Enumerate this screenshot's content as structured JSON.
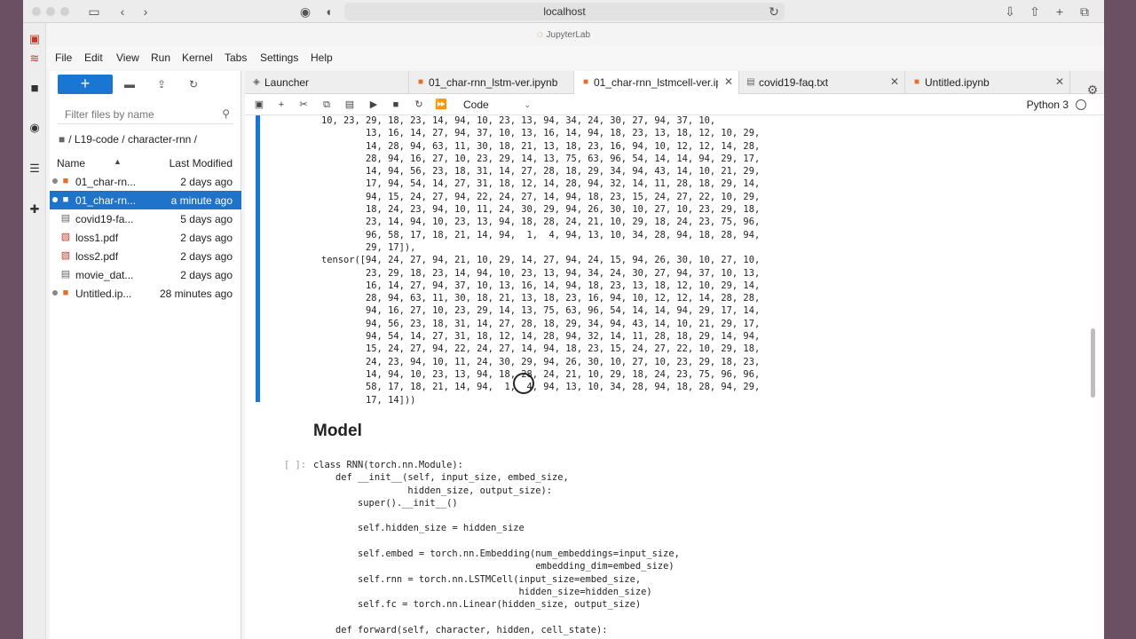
{
  "browser": {
    "url": "localhost",
    "app_name": "JupyterLab"
  },
  "menu": [
    "File",
    "Edit",
    "View",
    "Run",
    "Kernel",
    "Tabs",
    "Settings",
    "Help"
  ],
  "filebrowser": {
    "new_label": "+",
    "filter_placeholder": "Filter files by name",
    "breadcrumb": "/ L19-code / character-rnn /",
    "col_name": "Name",
    "col_modified": "Last Modified",
    "files": [
      {
        "name": "01_char-rn...",
        "modified": "2 days ago",
        "running": true,
        "selected": false,
        "icon": "notebook-icon"
      },
      {
        "name": "01_char-rn...",
        "modified": "a minute ago",
        "running": true,
        "selected": true,
        "icon": "notebook-icon"
      },
      {
        "name": "covid19-fa...",
        "modified": "5 days ago",
        "running": false,
        "selected": false,
        "icon": "file-icon"
      },
      {
        "name": "loss1.pdf",
        "modified": "2 days ago",
        "running": false,
        "selected": false,
        "icon": "pdf-icon"
      },
      {
        "name": "loss2.pdf",
        "modified": "2 days ago",
        "running": false,
        "selected": false,
        "icon": "pdf-icon"
      },
      {
        "name": "movie_dat...",
        "modified": "2 days ago",
        "running": false,
        "selected": false,
        "icon": "file-icon"
      },
      {
        "name": "Untitled.ip...",
        "modified": "28 minutes ago",
        "running": true,
        "selected": false,
        "icon": "notebook-icon"
      }
    ]
  },
  "tabs": [
    {
      "label": "Launcher",
      "active": false
    },
    {
      "label": "01_char-rnn_lstm-ver.ipynb",
      "active": false
    },
    {
      "label": "01_char-rnn_lstmcell-ver.ipy",
      "active": true
    },
    {
      "label": "covid19-faq.txt",
      "active": false
    },
    {
      "label": "Untitled.ipynb",
      "active": false
    }
  ],
  "toolbar": {
    "cell_type": "Code",
    "kernel_name": "Python 3"
  },
  "notebook": {
    "output_text": "10, 23, 29, 18, 23, 14, 94, 10, 23, 13, 94, 34, 24, 30, 27, 94, 37, 10,\n        13, 16, 14, 27, 94, 37, 10, 13, 16, 14, 94, 18, 23, 13, 18, 12, 10, 29,\n        14, 28, 94, 63, 11, 30, 18, 21, 13, 18, 23, 16, 94, 10, 12, 12, 14, 28,\n        28, 94, 16, 27, 10, 23, 29, 14, 13, 75, 63, 96, 54, 14, 14, 94, 29, 17,\n        14, 94, 56, 23, 18, 31, 14, 27, 28, 18, 29, 34, 94, 43, 14, 10, 21, 29,\n        17, 94, 54, 14, 27, 31, 18, 12, 14, 28, 94, 32, 14, 11, 28, 18, 29, 14,\n        94, 15, 24, 27, 94, 22, 24, 27, 14, 94, 18, 23, 15, 24, 27, 22, 10, 29,\n        18, 24, 23, 94, 10, 11, 24, 30, 29, 94, 26, 30, 10, 27, 10, 23, 29, 18,\n        23, 14, 94, 10, 23, 13, 94, 18, 28, 24, 21, 10, 29, 18, 24, 23, 75, 96,\n        96, 58, 17, 18, 21, 14, 94,  1,  4, 94, 13, 10, 34, 28, 94, 18, 28, 94,\n        29, 17]),\ntensor([94, 24, 27, 94, 21, 10, 29, 14, 27, 94, 24, 15, 94, 26, 30, 10, 27, 10,\n        23, 29, 18, 23, 14, 94, 10, 23, 13, 94, 34, 24, 30, 27, 94, 37, 10, 13,\n        16, 14, 27, 94, 37, 10, 13, 16, 14, 94, 18, 23, 13, 18, 12, 10, 29, 14,\n        28, 94, 63, 11, 30, 18, 21, 13, 18, 23, 16, 94, 10, 12, 12, 14, 28, 28,\n        94, 16, 27, 10, 23, 29, 14, 13, 75, 63, 96, 54, 14, 14, 94, 29, 17, 14,\n        94, 56, 23, 18, 31, 14, 27, 28, 18, 29, 34, 94, 43, 14, 10, 21, 29, 17,\n        94, 54, 14, 27, 31, 18, 12, 14, 28, 94, 32, 14, 11, 28, 18, 29, 14, 94,\n        15, 24, 27, 94, 22, 24, 27, 14, 94, 18, 23, 15, 24, 27, 22, 10, 29, 18,\n        24, 23, 94, 10, 11, 24, 30, 29, 94, 26, 30, 10, 27, 10, 23, 29, 18, 23,\n        14, 94, 10, 23, 13, 94, 18, 28, 24, 21, 10, 29, 18, 24, 23, 75, 96, 96,\n        58, 17, 18, 21, 14, 94,  1,  4, 94, 13, 10, 34, 28, 94, 18, 28, 94, 29,\n        17, 14]))",
    "heading": "Model",
    "prompt": "[ ]:",
    "code": "class RNN(torch.nn.Module):\n    def __init__(self, input_size, embed_size,\n                 hidden_size, output_size):\n        super().__init__()\n\n        self.hidden_size = hidden_size\n\n        self.embed = torch.nn.Embedding(num_embeddings=input_size,\n                                        embedding_dim=embed_size)\n        self.rnn = torch.nn.LSTMCell(input_size=embed_size,\n                                     hidden_size=hidden_size)\n        self.fc = torch.nn.Linear(hidden_size, output_size)\n\n    def forward(self, character, hidden, cell_state):"
  },
  "colors": {
    "accent": "#1976d2",
    "selection": "#1f73c9",
    "brand": "#e46e2e"
  }
}
